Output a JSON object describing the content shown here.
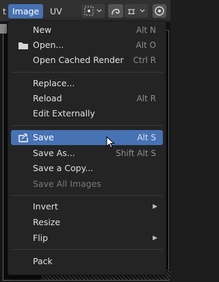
{
  "header": {
    "partial_tab": "t",
    "tabs": [
      {
        "label": "Image",
        "active": true
      },
      {
        "label": "UV",
        "active": false
      }
    ],
    "icons": [
      "pivot-icon",
      "proportional-edit-icon",
      "snap-icon",
      "overlay-icon"
    ]
  },
  "menu": {
    "items": [
      {
        "label": "New",
        "shortcut": "Alt N"
      },
      {
        "label": "Open...",
        "shortcut": "Alt O",
        "icon": "folder-icon"
      },
      {
        "label": "Open Cached Render",
        "shortcut": "Ctrl R"
      },
      {
        "label": "Replace...",
        "shortcut": ""
      },
      {
        "label": "Reload",
        "shortcut": "Alt R"
      },
      {
        "label": "Edit Externally",
        "shortcut": ""
      },
      {
        "label": "Save",
        "shortcut": "Alt S",
        "highlighted": true,
        "icon": "save-icon"
      },
      {
        "label": "Save As...",
        "shortcut": "Shift Alt S"
      },
      {
        "label": "Save a Copy...",
        "shortcut": ""
      },
      {
        "label": "Save All Images",
        "shortcut": "",
        "disabled": true
      },
      {
        "label": "Invert",
        "submenu": true
      },
      {
        "label": "Resize",
        "shortcut": ""
      },
      {
        "label": "Flip",
        "submenu": true
      },
      {
        "label": "Pack",
        "shortcut": ""
      }
    ]
  },
  "colors": {
    "accent": "#4772b3",
    "menu_bg": "#242424",
    "header_bg": "#303030"
  }
}
